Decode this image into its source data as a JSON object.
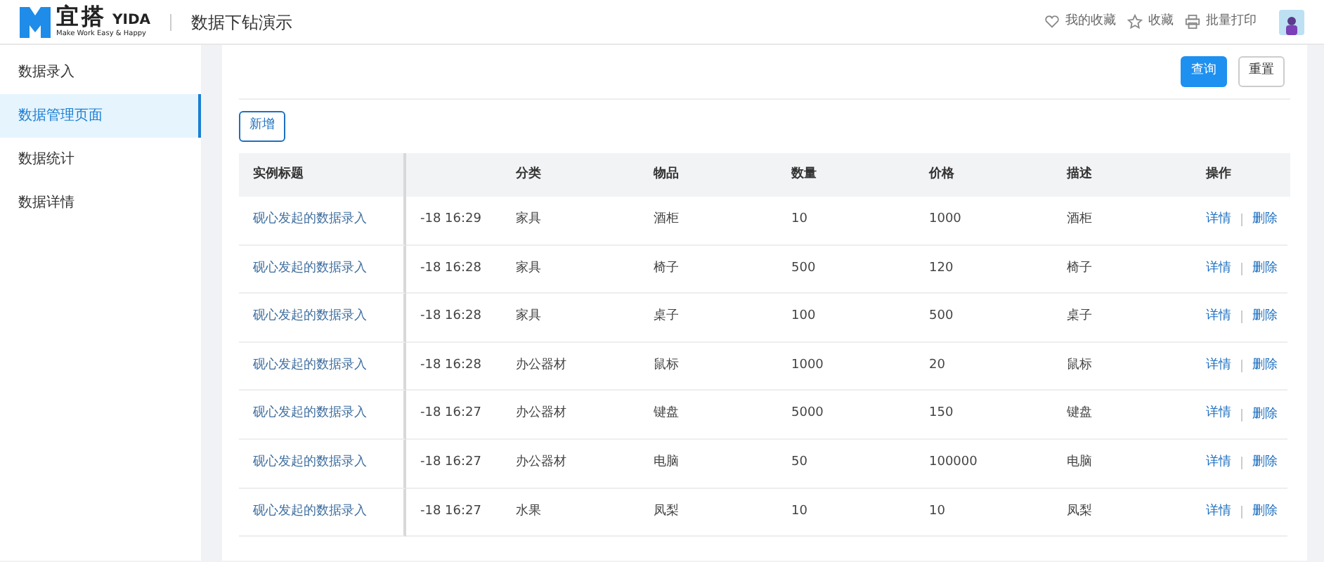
{
  "header": {
    "logo_name": "宜搭",
    "logo_brand": "YIDA",
    "logo_tagline": "Make Work Easy & Happy",
    "page_title": "数据下钻演示",
    "actions": [
      {
        "kind": "heart",
        "label": "我的收藏"
      },
      {
        "kind": "star",
        "label": "收藏"
      },
      {
        "kind": "printer",
        "label": "批量打印"
      }
    ]
  },
  "sidebar": {
    "items": [
      {
        "label": "数据录入",
        "selected": false
      },
      {
        "label": "数据管理页面",
        "selected": true
      },
      {
        "label": "数据统计",
        "selected": false
      },
      {
        "label": "数据详情",
        "selected": false
      }
    ]
  },
  "toolbar": {
    "search_button": "查询",
    "reset_button": "重置",
    "add_button": "新增"
  },
  "table": {
    "columns": [
      "实例标题",
      "",
      "分类",
      "物品",
      "数量",
      "价格",
      "描述",
      "操作"
    ],
    "rows": [
      {
        "title": "砚心发起的数据录入",
        "time": "-18 16:29",
        "category": "家具",
        "item": "酒柜",
        "quantity": "10",
        "price": "1000",
        "description": "酒柜",
        "actions": [
          "详情",
          "删除"
        ]
      },
      {
        "title": "砚心发起的数据录入",
        "time": "-18 16:28",
        "category": "家具",
        "item": "椅子",
        "quantity": "500",
        "price": "120",
        "description": "椅子",
        "actions": [
          "详情",
          "删除"
        ]
      },
      {
        "title": "砚心发起的数据录入",
        "time": "-18 16:28",
        "category": "家具",
        "item": "桌子",
        "quantity": "100",
        "price": "500",
        "description": "桌子",
        "actions": [
          "详情",
          "删除"
        ]
      },
      {
        "title": "砚心发起的数据录入",
        "time": "-18 16:28",
        "category": "办公器材",
        "item": "鼠标",
        "quantity": "1000",
        "price": "20",
        "description": "鼠标",
        "actions": [
          "详情",
          "删除"
        ]
      },
      {
        "title": "砚心发起的数据录入",
        "time": "-18 16:27",
        "category": "办公器材",
        "item": "键盘",
        "quantity": "5000",
        "price": "150",
        "description": "键盘",
        "actions": [
          "详情",
          "删除"
        ]
      },
      {
        "title": "砚心发起的数据录入",
        "time": "-18 16:27",
        "category": "办公器材",
        "item": "电脑",
        "quantity": "50",
        "price": "100000",
        "description": "电脑",
        "actions": [
          "详情",
          "删除"
        ]
      },
      {
        "title": "砚心发起的数据录入",
        "time": "-18 16:27",
        "category": "水果",
        "item": "凤梨",
        "quantity": "10",
        "price": "10",
        "description": "凤梨",
        "actions": [
          "详情",
          "删除"
        ]
      }
    ]
  }
}
